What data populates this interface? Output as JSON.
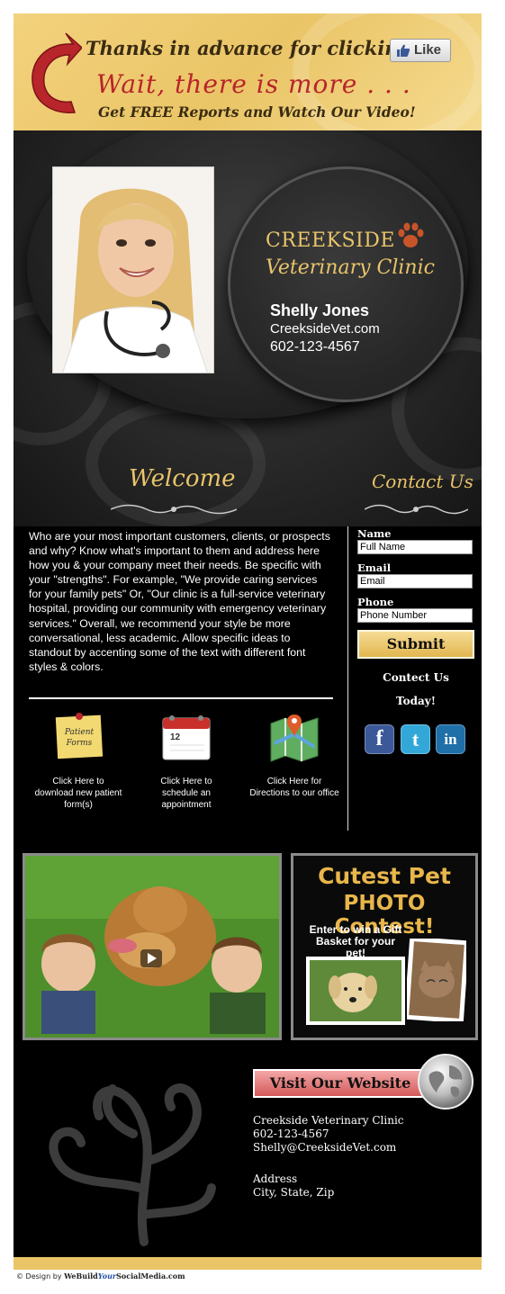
{
  "banner": {
    "line1": "Thanks in advance for clicking",
    "like_label": "Like",
    "line2": "Wait, there is more . . .",
    "line3": "Get FREE Reports and Watch Our Video!"
  },
  "hero": {
    "clinic_line1": "CREEKSIDE",
    "clinic_line2": "Veterinary Clinic",
    "person_name": "Shelly Jones",
    "website": "CreeksideVet.com",
    "phone": "602-123-4567",
    "welcome_heading": "Welcome",
    "contact_heading": "Contact Us"
  },
  "main": {
    "welcome_text": "Who are your most important customers, clients, or prospects and why? Know what's important to them and address here how you & your company meet their needs. Be specific with your \"strengths\". For example, \"We provide caring services for your family pets\" Or, \"Our clinic is a full-service veterinary hospital, providing our community with emergency veterinary services.\" Overall, we recommend your style be more conversational, less academic. Allow specific ideas to standout by accenting some of the text with different font styles & colors.",
    "icons": [
      {
        "icon": "patient-forms-note-icon",
        "note_text": "Patient Forms",
        "caption": "Click Here to download new patient form(s)"
      },
      {
        "icon": "calendar-icon",
        "calendar_day": "12",
        "caption": "Click Here to schedule an appointment"
      },
      {
        "icon": "map-directions-icon",
        "caption": "Click Here for Directions to our office"
      }
    ]
  },
  "form": {
    "name_label": "Name",
    "name_value": "Full Name",
    "email_label": "Email",
    "email_value": "Email",
    "phone_label": "Phone",
    "phone_value": "Phone Number",
    "submit_label": "Submit",
    "contact_line1": "Contect Us",
    "contact_line2": "Today!",
    "social": [
      {
        "icon": "facebook-icon",
        "glyph": "f",
        "color": "#3b5998"
      },
      {
        "icon": "twitter-icon",
        "glyph": "t",
        "color": "#33a8d8"
      },
      {
        "icon": "linkedin-icon",
        "glyph": "in",
        "color": "#1f6fa8"
      }
    ]
  },
  "contest": {
    "title1": "Cutest Pet",
    "title2": "PHOTO Contest!",
    "subtitle": "Enter to win a Gift Basket for your pet!"
  },
  "footer": {
    "visit_label": "Visit Our Website",
    "clinic": "Creekside Veterinary Clinic",
    "phone": "602-123-4567",
    "email": "Shelly@CreeksideVet.com",
    "address": "Address",
    "city": "City, State, Zip"
  },
  "credit": {
    "prefix": "© Design by ",
    "brand_a": "WeBuild",
    "brand_b": "Your",
    "brand_c": "SocialMedia",
    "brand_d": ".com"
  },
  "colors": {
    "banner_gold": "#eac567",
    "accent_gold": "#e8c46a",
    "banner_red": "#b8252a",
    "visit_red": "#d45959"
  }
}
